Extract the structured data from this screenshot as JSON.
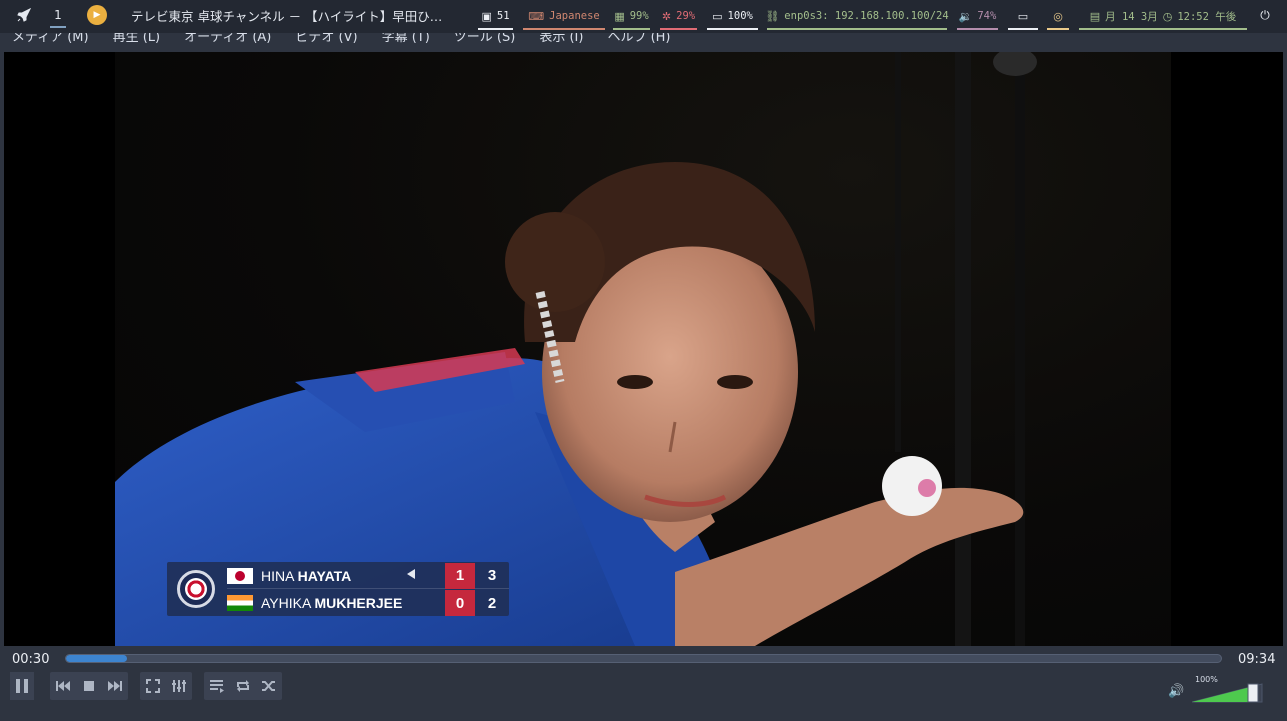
{
  "topbar": {
    "workspace": "1",
    "window_title": "テレビ東京 卓球チャンネル － 【ハイライト】早田ひ…",
    "modules": [
      {
        "icon": "package-icon",
        "glyph": "▣",
        "text": "51",
        "color": "#eceff4",
        "underline": "#eceff4"
      },
      {
        "icon": "keyboard-icon",
        "glyph": "⌨",
        "text": "Japanese",
        "color": "#d08770",
        "underline": "#d08770"
      },
      {
        "icon": "memory-icon",
        "glyph": "▦",
        "text": "99%",
        "color": "#a3be8c",
        "underline": "#a3be8c"
      },
      {
        "icon": "cpu-icon",
        "glyph": "✲",
        "text": "29%",
        "color": "#e06c75",
        "underline": "#e06c75"
      },
      {
        "icon": "battery-icon",
        "glyph": "▭",
        "text": "100%",
        "color": "#eceff4",
        "underline": "#eceff4"
      },
      {
        "icon": "network-icon",
        "glyph": "⛓",
        "text": "enp0s3: 192.168.100.100/24",
        "color": "#a3be8c",
        "underline": "#a3be8c"
      },
      {
        "icon": "speaker-icon",
        "glyph": "🔉",
        "text": "74%",
        "color": "#b48ead",
        "underline": "#b48ead"
      },
      {
        "icon": "display-icon",
        "glyph": "▭",
        "text": "",
        "color": "#eceff4",
        "underline": "#eceff4"
      },
      {
        "icon": "eye-slash-icon",
        "glyph": "◎",
        "text": "",
        "color": "#ebcb8b",
        "underline": "#ebcb8b"
      },
      {
        "icon": "calendar-icon",
        "glyph": "▤",
        "text": "月 14  3月",
        "color": "#a3be8c",
        "underline": "#a3be8c",
        "extra_icon": "clock-icon",
        "extra_glyph": "◷",
        "extra_text": "12:52 午後"
      }
    ]
  },
  "menubar": {
    "items": [
      "メディア (M)",
      "再生 (L)",
      "オーディオ (A)",
      "ビデオ (V)",
      "字幕 (T)",
      "ツール (S)",
      "表示 (I)",
      "ヘルプ (H)"
    ]
  },
  "scoreboard": {
    "players": [
      {
        "first": "HINA",
        "last": "HAYATA",
        "points": "1",
        "games": "3",
        "serving": true
      },
      {
        "first": "AYHIKA",
        "last": "MUKHERJEE",
        "points": "0",
        "games": "2",
        "serving": false
      }
    ]
  },
  "player": {
    "elapsed": "00:30",
    "total": "09:34",
    "progress": 0.053,
    "volume_label": "100%",
    "volume": 1.0
  }
}
